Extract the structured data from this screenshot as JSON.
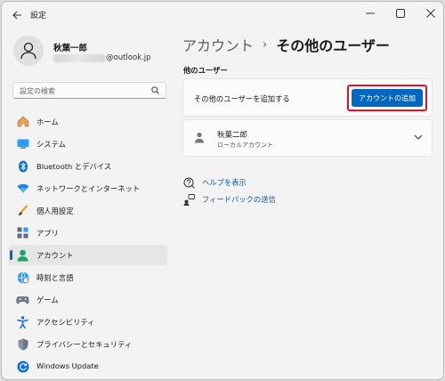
{
  "window": {
    "title": "設定"
  },
  "profile": {
    "name": "秋葉一郎",
    "email_suffix": "@outlook.jp"
  },
  "search": {
    "placeholder": "設定の検索"
  },
  "nav": {
    "items": [
      {
        "label": "ホーム",
        "icon": "home-icon"
      },
      {
        "label": "システム",
        "icon": "system-icon"
      },
      {
        "label": "Bluetooth とデバイス",
        "icon": "bluetooth-icon"
      },
      {
        "label": "ネットワークとインターネット",
        "icon": "network-icon"
      },
      {
        "label": "個人用設定",
        "icon": "personalization-icon"
      },
      {
        "label": "アプリ",
        "icon": "apps-icon"
      },
      {
        "label": "アカウント",
        "icon": "accounts-icon",
        "active": true
      },
      {
        "label": "時刻と言語",
        "icon": "time-language-icon"
      },
      {
        "label": "ゲーム",
        "icon": "gaming-icon"
      },
      {
        "label": "アクセシビリティ",
        "icon": "accessibility-icon"
      },
      {
        "label": "プライバシーとセキュリティ",
        "icon": "privacy-shield-icon"
      },
      {
        "label": "Windows Update",
        "icon": "windows-update-icon"
      }
    ]
  },
  "main": {
    "breadcrumb_parent": "アカウント",
    "breadcrumb_separator": "›",
    "breadcrumb_current": "その他のユーザー",
    "section_title": "他のユーザー",
    "add_card_label": "その他のユーザーを追加する",
    "add_button": "アカウントの追加",
    "user": {
      "name": "秋葉二郎",
      "type": "ローカルアカウント"
    },
    "links": [
      {
        "label": "ヘルプを表示",
        "icon": "help-icon"
      },
      {
        "label": "フィードバックの送信",
        "icon": "feedback-icon"
      }
    ]
  },
  "colors": {
    "accent": "#0067c0",
    "highlight": "#e81123",
    "link": "#0b5cad"
  }
}
